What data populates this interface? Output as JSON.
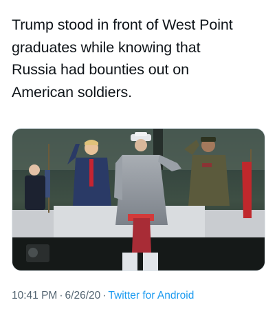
{
  "tweet": {
    "text_lines": [
      "Trump stood in front of West Point",
      "graduates while knowing that",
      "Russia had bounties out on",
      "American soldiers."
    ],
    "time": "10:41 PM",
    "date": "6/26/20",
    "separator": "·",
    "source": "Twitter for Android"
  },
  "colors": {
    "text": "#0f1419",
    "meta": "#536471",
    "link": "#1d9bf0"
  }
}
